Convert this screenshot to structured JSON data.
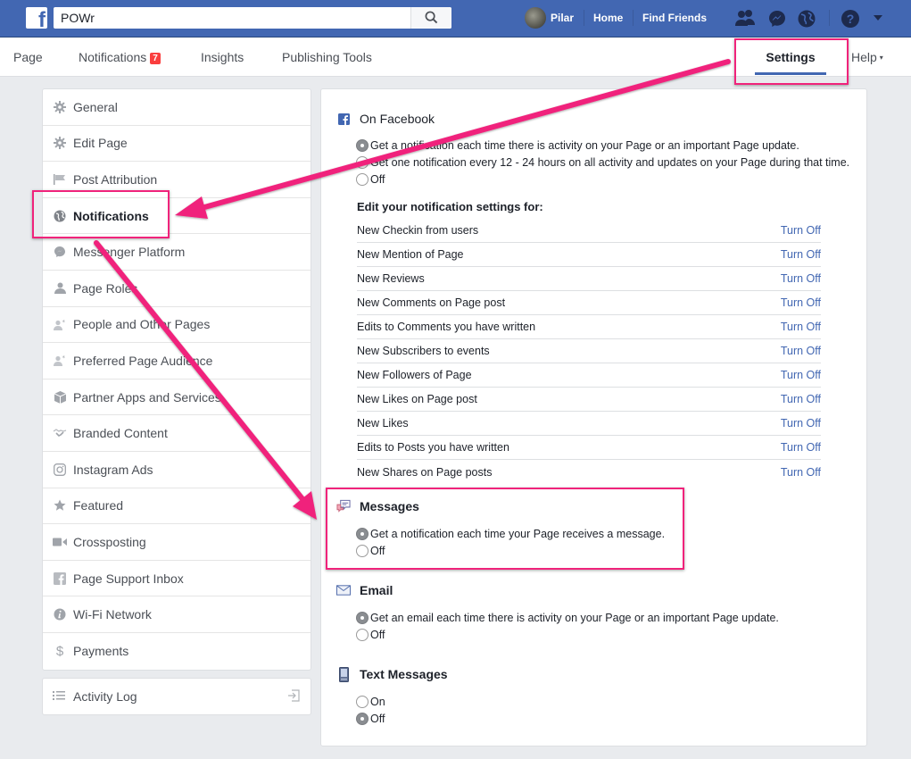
{
  "topbar": {
    "logo": "f",
    "search_value": "POWr",
    "search_icon": "search-icon",
    "user_name": "Pilar",
    "home": "Home",
    "find_friends": "Find Friends",
    "icons": [
      "friend-requests-icon",
      "messenger-icon",
      "globe-notifications-icon",
      "help-icon",
      "account-menu-caret-icon"
    ]
  },
  "pagebar": {
    "tabs": [
      {
        "label": "Page"
      },
      {
        "label": "Notifications",
        "badge": "7"
      },
      {
        "label": "Insights"
      },
      {
        "label": "Publishing Tools"
      }
    ],
    "settings": "Settings",
    "help": "Help",
    "help_caret": "▾"
  },
  "sidebar": {
    "items": [
      {
        "label": "General",
        "icon": "gear-icon"
      },
      {
        "label": "Edit Page",
        "icon": "gear-icon"
      },
      {
        "label": "Post Attribution",
        "icon": "flag-icon"
      },
      {
        "label": "Notifications",
        "icon": "globe-icon",
        "active": true
      },
      {
        "label": "Messenger Platform",
        "icon": "messenger-icon"
      },
      {
        "label": "Page Roles",
        "icon": "person-icon"
      },
      {
        "label": "People and Other Pages",
        "icon": "person-star-icon"
      },
      {
        "label": "Preferred Page Audience",
        "icon": "person-star-icon"
      },
      {
        "label": "Partner Apps and Services",
        "icon": "cube-icon"
      },
      {
        "label": "Branded Content",
        "icon": "handshake-icon"
      },
      {
        "label": "Instagram Ads",
        "icon": "instagram-icon"
      },
      {
        "label": "Featured",
        "icon": "star-icon"
      },
      {
        "label": "Crossposting",
        "icon": "video-camera-icon"
      },
      {
        "label": "Page Support Inbox",
        "icon": "facebook-square-icon"
      },
      {
        "label": "Wi-Fi Network",
        "icon": "info-icon"
      },
      {
        "label": "Payments",
        "icon": "dollar-icon"
      }
    ],
    "activity_log": "Activity Log"
  },
  "main": {
    "on_facebook": {
      "title": "On Facebook",
      "options": [
        {
          "label": "Get a notification each time there is activity on your Page or an important Page update.",
          "checked": true
        },
        {
          "label": "Get one notification every 12 - 24 hours on all activity and updates on your Page during that time.",
          "checked": false
        },
        {
          "label": "Off",
          "checked": false
        }
      ]
    },
    "edit_title": "Edit your notification settings for:",
    "turn_off_label": "Turn Off",
    "notifications": [
      "New Checkin from users",
      "New Mention of Page",
      "New Reviews",
      "New Comments on Page post",
      "Edits to Comments you have written",
      "New Subscribers to events",
      "New Followers of Page",
      "New Likes on Page post",
      "New Likes",
      "Edits to Posts you have written",
      "New Shares on Page posts"
    ],
    "messages": {
      "title": "Messages",
      "options": [
        {
          "label": "Get a notification each time your Page receives a message.",
          "checked": true
        },
        {
          "label": "Off",
          "checked": false
        }
      ]
    },
    "email": {
      "title": "Email",
      "options": [
        {
          "label": "Get an email each time there is activity on your Page or an important Page update.",
          "checked": true
        },
        {
          "label": "Off",
          "checked": false
        }
      ]
    },
    "text_messages": {
      "title": "Text Messages",
      "options": [
        {
          "label": "On",
          "checked": false
        },
        {
          "label": "Off",
          "checked": true
        }
      ]
    }
  },
  "colors": {
    "brand_blue": "#4267b2",
    "annotation_pink": "#f0237b",
    "badge_red": "#fa3e3e"
  }
}
